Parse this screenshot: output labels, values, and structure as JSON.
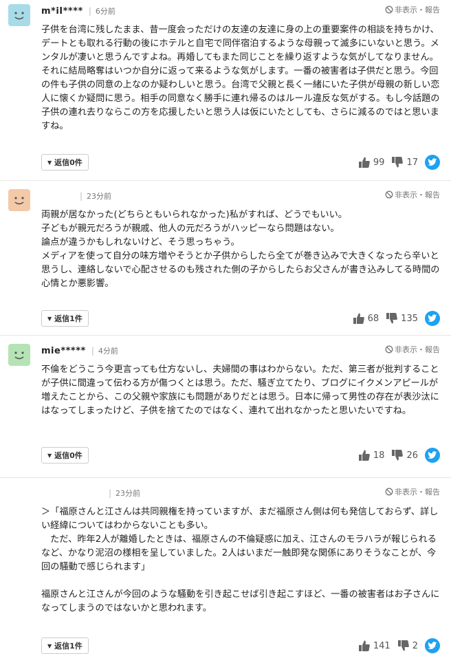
{
  "comments": [
    {
      "username": "m*iI****",
      "time": "6分前",
      "hide_report": "非表示・報告",
      "avatar_color": "#a8dbe8",
      "body": "子供を台湾に残したまま、昔一度会っただけの友達の友達に身の上の重要案件の相談を持ちかけ、デートとも取れる行動の後にホテルと自宅で同伴宿泊するような母親って滅多にいないと思う。メンタルが凄いと思うんですよね。再婚してもまた同じことを繰り返すような気がしてなりません。それに結局略奪はいつか自分に返って来るような気がします。一番の被害者は子供だと思う。今回の件も子供の同意の上なのか疑わしいと思う。台湾で父親と長く一緒にいた子供が母親の新しい恋人に懐くか疑問に思う。相手の同意なく勝手に連れ帰るのはルール違反な気がする。もし今話題の子供の連れ去りならこの方を応援したいと思う人は仮にいたとしても、さらに減るのではと思いますね。",
      "reply_label": "返信0件",
      "likes": "99",
      "dislikes": "17"
    },
    {
      "username": "",
      "time": "23分前",
      "hide_report": "非表示・報告",
      "avatar_color": "#f4c9a8",
      "body": "両親が居なかった(どちらともいられなかった)私がすれば、どうでもいい。\n子どもが親元だろうが親戚、他人の元だろうがハッピーなら問題はない。\n論点が違うかもしれないけど、そう思っちゃう。\nメディアを使って自分の味方増やそうとか子供からしたら全てが巻き込みで大きくなったら辛いと思うし、連絡しないで心配させるのも残された側の子からしたらお父さんが書き込みしてる時間の心情とか悪影響。",
      "reply_label": "返信1件",
      "likes": "68",
      "dislikes": "135"
    },
    {
      "username": "mie*****",
      "time": "4分前",
      "hide_report": "非表示・報告",
      "avatar_color": "#b5e3b5",
      "body": "不倫をどうこう今更言っても仕方ないし、夫婦間の事はわからない。ただ、第三者が批判することが子供に間違って伝わる方が傷つくとは思う。ただ、騒ぎ立てたり、ブログにイクメンアピールが増えたことから、この父親や家族にも問題がありだとは思う。日本に帰って男性の存在が表沙汰にはなってしまったけど、子供を捨てたのではなく、連れて出れなかったと思いたいですね。",
      "reply_label": "返信0件",
      "likes": "18",
      "dislikes": "26"
    },
    {
      "username": "",
      "time": "23分前",
      "hide_report": "非表示・報告",
      "avatar_color": "",
      "body": "＞「福原さんと江さんは共同親権を持っていますが、まだ福原さん側は何も発信しておらず、詳しい経緯についてはわからないことも多い。\n　ただ、昨年2人が離婚したときは、福原さんの不倫疑惑に加え、江さんのモラハラが報じられるなど、かなり泥沼の様相を呈していました。2人はいまだ一触即発な関係にありそうなことが、今回の騒動で感じられます」\n\n福原さんと江さんが今回のような騒動を引き起こせば引き起こすほど、一番の被害者はお子さんになってしまうのではないかと思われます。",
      "reply_label": "返信1件",
      "likes": "141",
      "dislikes": "2"
    }
  ]
}
